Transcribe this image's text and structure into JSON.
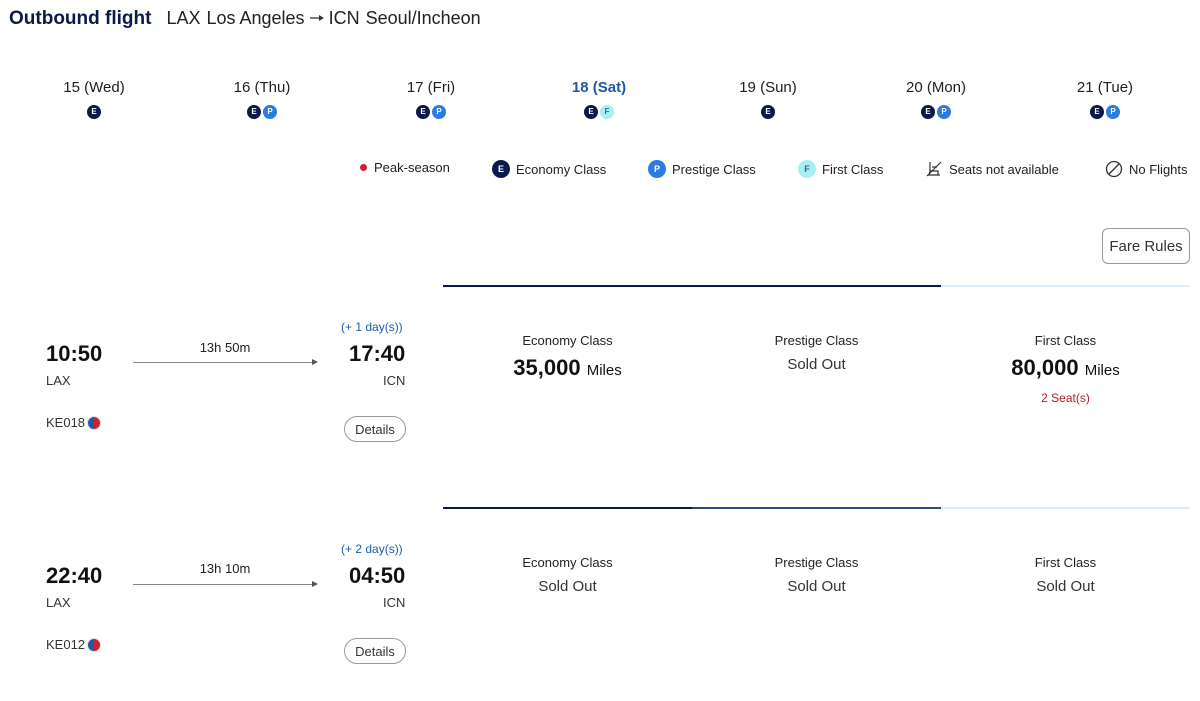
{
  "header": {
    "title": "Outbound flight",
    "origin_code": "LAX",
    "origin_city": "Los Angeles",
    "dest_code": "ICN",
    "dest_city": "Seoul/Incheon"
  },
  "dates": [
    {
      "label": "15 (Wed)",
      "classes": [
        "E"
      ],
      "selected": false
    },
    {
      "label": "16 (Thu)",
      "classes": [
        "E",
        "P"
      ],
      "selected": false
    },
    {
      "label": "17 (Fri)",
      "classes": [
        "E",
        "P"
      ],
      "selected": false
    },
    {
      "label": "18 (Sat)",
      "classes": [
        "E",
        "F"
      ],
      "selected": true
    },
    {
      "label": "19 (Sun)",
      "classes": [
        "E"
      ],
      "selected": false
    },
    {
      "label": "20 (Mon)",
      "classes": [
        "E",
        "P"
      ],
      "selected": false
    },
    {
      "label": "21 (Tue)",
      "classes": [
        "E",
        "P"
      ],
      "selected": false
    }
  ],
  "legend": {
    "peak": "Peak-season",
    "economy": "Economy Class",
    "prestige": "Prestige Class",
    "first": "First Class",
    "seats_na": "Seats not available",
    "no_flights": "No Flights",
    "e_letter": "E",
    "p_letter": "P",
    "f_letter": "F"
  },
  "fare_rules_label": "Fare Rules",
  "flights": [
    {
      "dep_time": "10:50",
      "dep_airport": "LAX",
      "duration": "13h 50m",
      "plus_day": "(+ 1 day(s))",
      "arr_time": "17:40",
      "arr_airport": "ICN",
      "flight_no": "KE018",
      "details_label": "Details",
      "economy": {
        "name": "Economy Class",
        "miles": "35,000",
        "unit": "Miles",
        "status": ""
      },
      "prestige": {
        "name": "Prestige Class",
        "miles": "",
        "unit": "",
        "status": "Sold Out"
      },
      "first": {
        "name": "First Class",
        "miles": "80,000",
        "unit": "Miles",
        "status": "",
        "seats": "2 Seat(s)"
      }
    },
    {
      "dep_time": "22:40",
      "dep_airport": "LAX",
      "duration": "13h 10m",
      "plus_day": "(+ 2 day(s))",
      "arr_time": "04:50",
      "arr_airport": "ICN",
      "flight_no": "KE012",
      "details_label": "Details",
      "economy": {
        "name": "Economy Class",
        "miles": "",
        "unit": "",
        "status": "Sold Out"
      },
      "prestige": {
        "name": "Prestige Class",
        "miles": "",
        "unit": "",
        "status": "Sold Out"
      },
      "first": {
        "name": "First Class",
        "miles": "",
        "unit": "",
        "status": "Sold Out"
      }
    }
  ],
  "colors": {
    "economy": "#0b1a4a",
    "prestige": "#2c7ce0",
    "first": "#a9edf6",
    "peak": "#d0202b",
    "selected_date": "#1e5aa8"
  }
}
